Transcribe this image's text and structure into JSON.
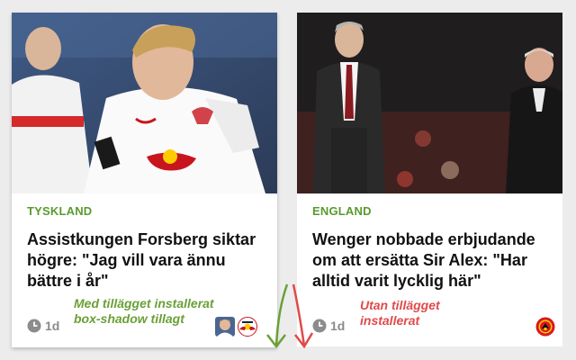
{
  "cards": [
    {
      "category": "Tyskland",
      "headline": "Assistkungen Forsberg siktar högre: \"Jag vill vara ännu bättre i år\"",
      "time": "1d",
      "badges": [
        "player-avatar-icon",
        "rb-leipzig-logo-icon"
      ]
    },
    {
      "category": "England",
      "headline": "Wenger nobbade erbjudande om att ersätta Sir Alex: \"Har alltid varit lycklig här\"",
      "time": "1d",
      "badges": [
        "manchester-united-logo-icon"
      ]
    }
  ],
  "annotations": {
    "with_addon": "Med tillägget installerat box-shadow tillagt",
    "without_addon": "Utan tillägget installerat"
  },
  "colors": {
    "category_green": "#5a9a2e",
    "note_green": "#6aa036",
    "note_red": "#e04a4a",
    "page_background": "#ececec"
  }
}
